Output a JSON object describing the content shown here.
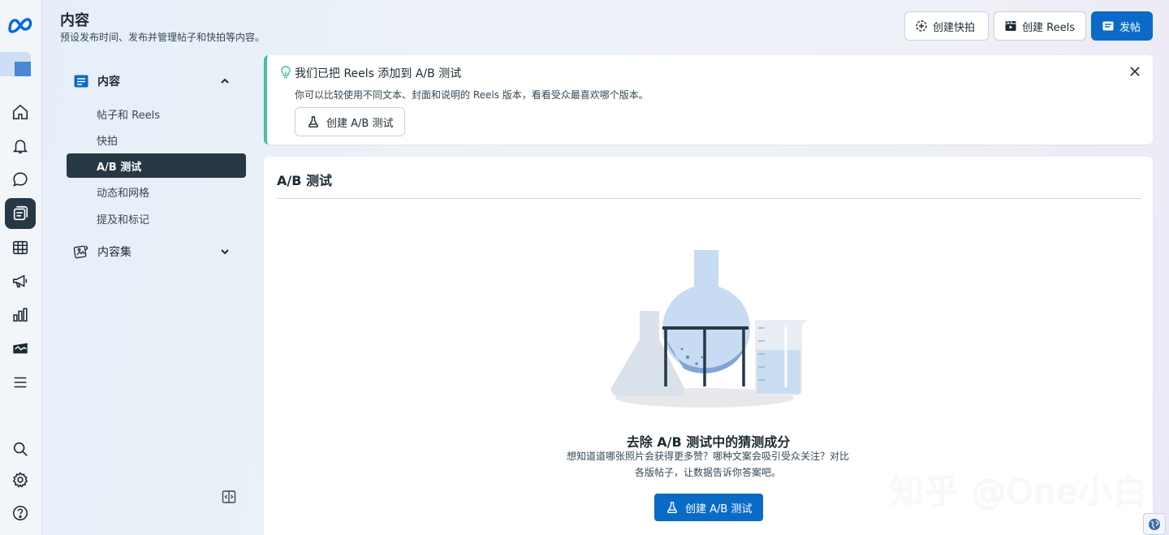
{
  "header": {
    "title": "内容",
    "subtitle": "预设发布时间、发布并管理帖子和快拍等内容。",
    "buttons": {
      "create_story": "创建快拍",
      "create_reels": "创建 Reels",
      "post": "发帖"
    }
  },
  "sidebar": {
    "content_section": "内容",
    "items": [
      {
        "label": "帖子和 Reels"
      },
      {
        "label": "快拍"
      },
      {
        "label": "A/B 测试"
      },
      {
        "label": "动态和网格"
      },
      {
        "label": "提及和标记"
      }
    ],
    "collections_section": "内容集"
  },
  "banner": {
    "title": "我们已把 Reels 添加到 A/B 测试",
    "description": "你可以比较使用不同文本、封面和说明的 Reels 版本，看看受众最喜欢哪个版本。",
    "button_label": "创建 A/B 测试"
  },
  "main": {
    "title": "A/B 测试",
    "empty_title": "去除 A/B 测试中的猜测成分",
    "empty_description_line1": "想知道道哪张照片会获得更多赞？哪种文案会吸引受众关注？对比",
    "empty_description_line2": "各版帖子，让数据告诉你答案吧。",
    "cta_label": "创建 A/B 测试"
  },
  "watermark": "知乎 @One小白",
  "colors": {
    "accent": "#0a6bc7",
    "active_nav": "#263843",
    "banner_accent": "#45c1a0"
  },
  "icons": [
    "meta-logo",
    "home-icon",
    "bell-icon",
    "chat-icon",
    "content-icon",
    "table-icon",
    "megaphone-icon",
    "bar-chart-icon",
    "briefcase-icon",
    "menu-icon",
    "search-icon",
    "gear-icon",
    "help-icon",
    "collapse-sidebar-icon",
    "lightbulb-icon",
    "close-icon",
    "flask-icon",
    "globe-icon"
  ]
}
